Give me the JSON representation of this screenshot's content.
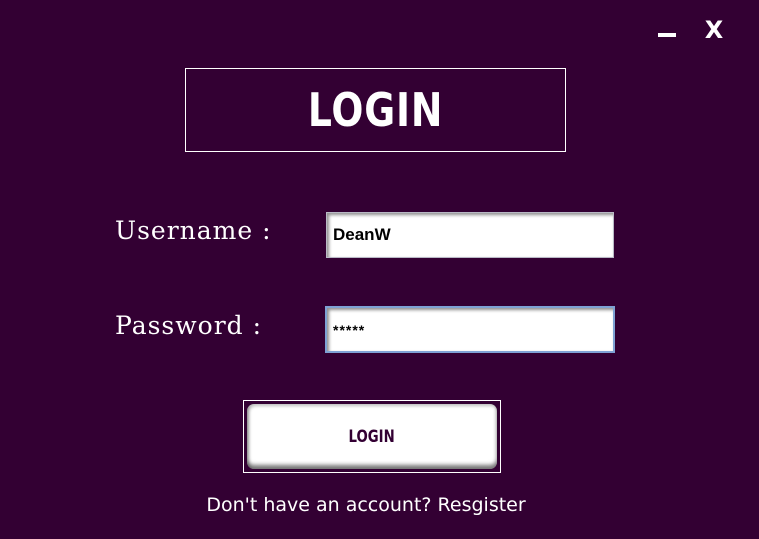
{
  "window_controls": {
    "close_label": "X"
  },
  "header": {
    "title": "LOGIN"
  },
  "form": {
    "username_label": "Username :",
    "username_value": "DeanW",
    "password_label": "Password :",
    "password_value": "*****",
    "login_button_label": "LOGIN",
    "register_text": "Don't have an account? Resgister"
  },
  "colors": {
    "background": "#330033",
    "button_text": "#330033",
    "focus_border": "#7ea2d4"
  }
}
